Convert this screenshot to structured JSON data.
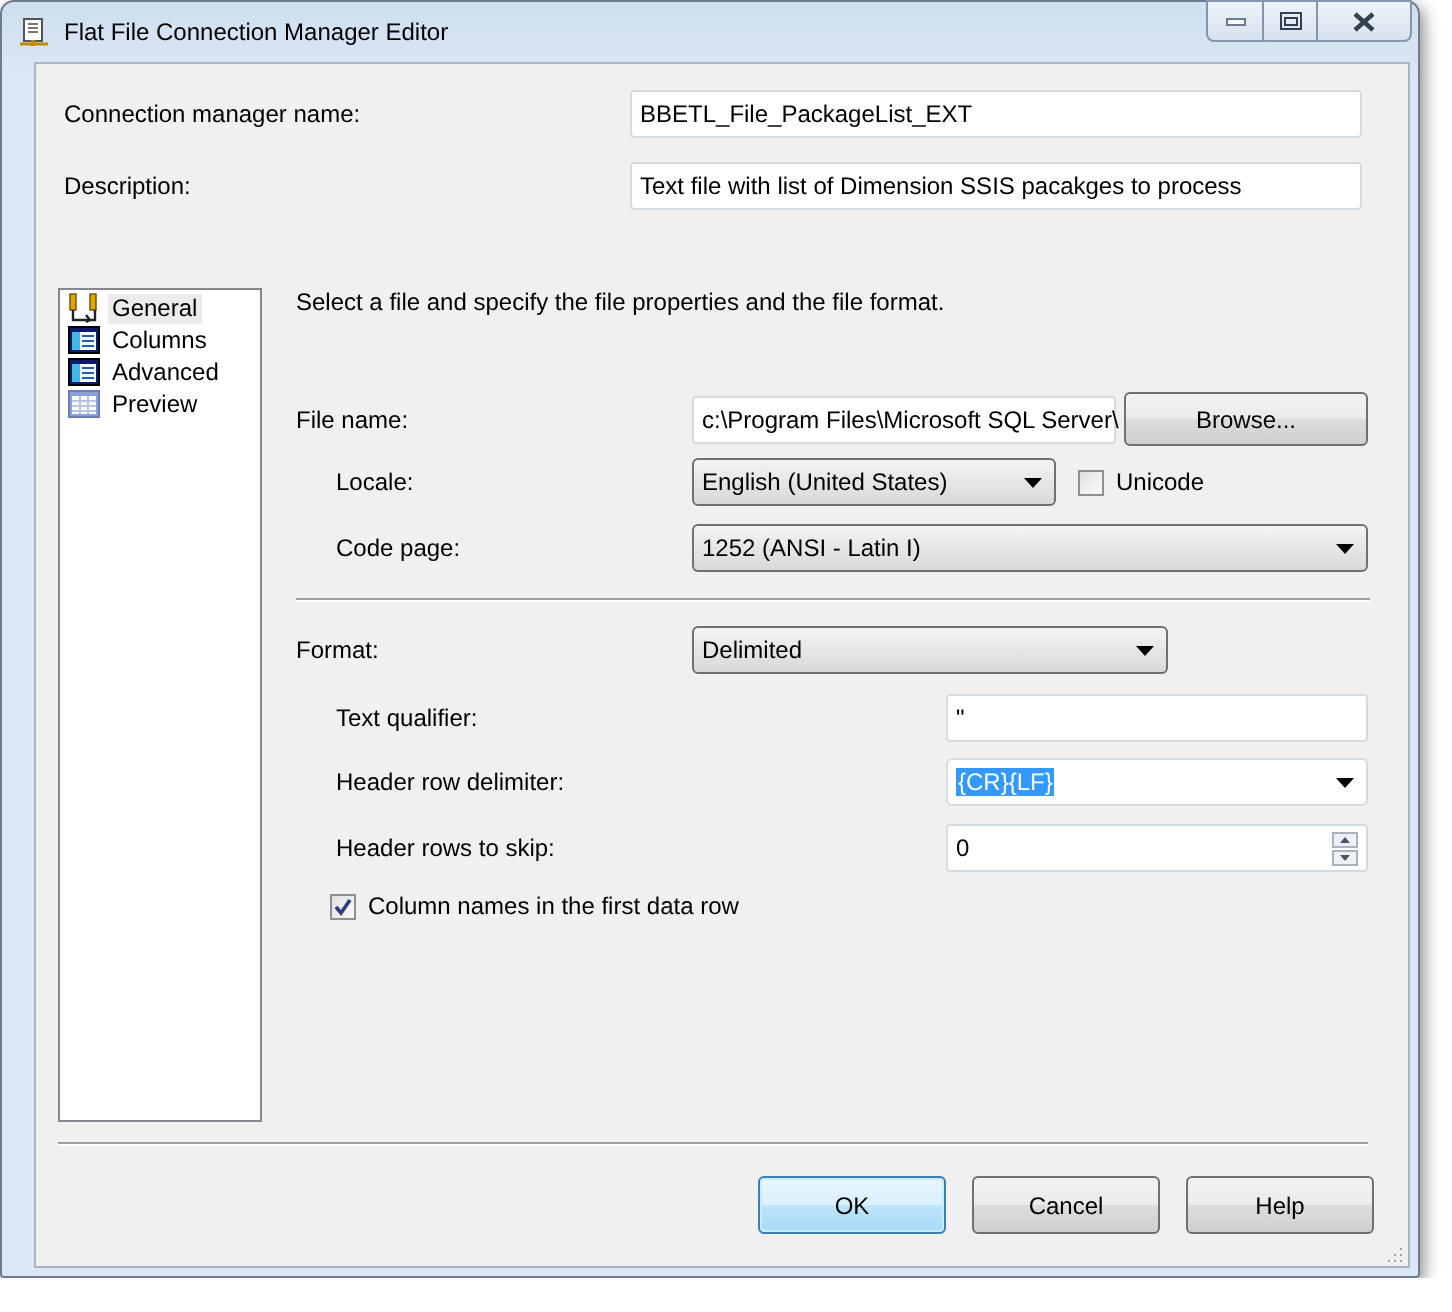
{
  "window": {
    "title": "Flat File Connection Manager Editor"
  },
  "connection_manager_name": {
    "label": "Connection manager name:",
    "value": "BBETL_File_PackageList_EXT"
  },
  "description": {
    "label": "Description:",
    "value": "Text file with list of Dimension SSIS pacakges to process"
  },
  "sidebar": {
    "items": [
      {
        "label": "General",
        "selected": true
      },
      {
        "label": "Columns",
        "selected": false
      },
      {
        "label": "Advanced",
        "selected": false
      },
      {
        "label": "Preview",
        "selected": false
      }
    ]
  },
  "general": {
    "intro": "Select a file and specify the file properties and the file format.",
    "file_name": {
      "label": "File name:",
      "value": "c:\\Program Files\\Microsoft SQL Server\\"
    },
    "browse_button": "Browse...",
    "locale": {
      "label": "Locale:",
      "value": "English (United States)"
    },
    "unicode": {
      "label": "Unicode",
      "checked": false
    },
    "code_page": {
      "label": "Code page:",
      "value": "1252  (ANSI - Latin I)"
    },
    "format": {
      "label": "Format:",
      "value": "Delimited"
    },
    "text_qualifier": {
      "label": "Text qualifier:",
      "value": "\""
    },
    "header_row_delimiter": {
      "label": "Header row delimiter:",
      "value": "{CR}{LF}",
      "selected": true
    },
    "header_rows_to_skip": {
      "label": "Header rows to skip:",
      "value": "0"
    },
    "column_names": {
      "label": "Column names in the first data row",
      "checked": true
    }
  },
  "buttons": [
    {
      "label": "OK",
      "default": true
    },
    {
      "label": "Cancel",
      "default": false
    },
    {
      "label": "Help",
      "default": false
    }
  ]
}
